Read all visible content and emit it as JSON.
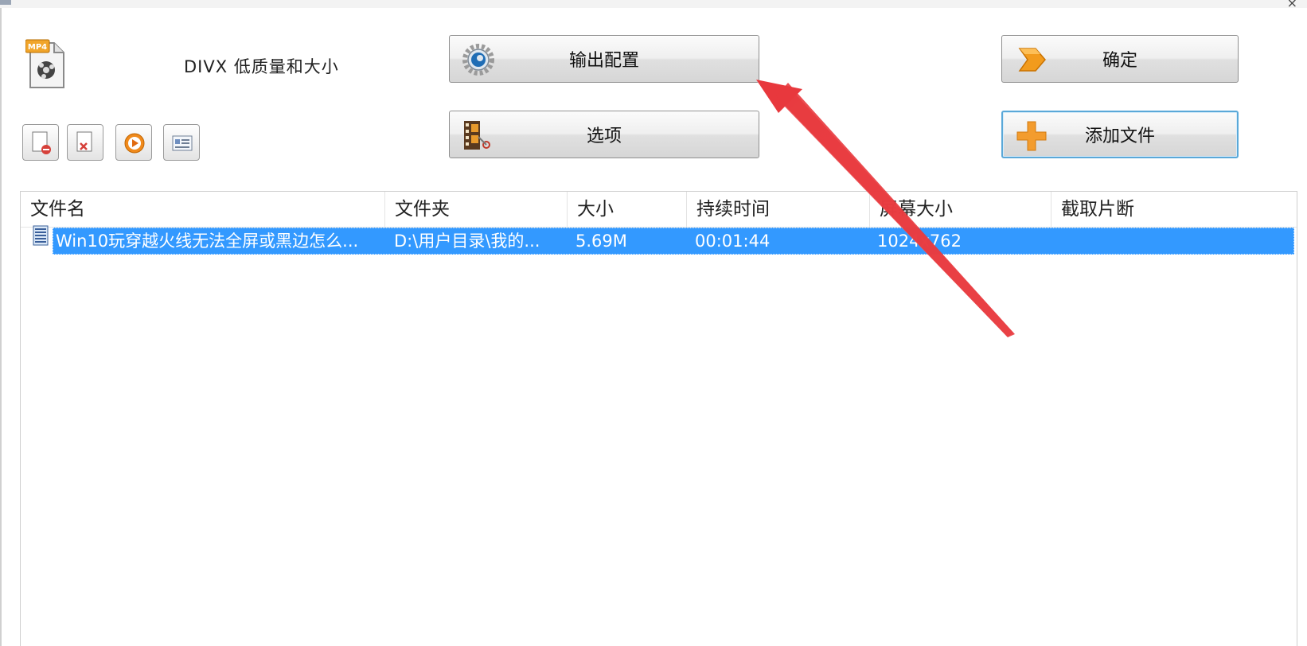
{
  "window": {
    "close_glyph": "×"
  },
  "profile": {
    "label": "DIVX 低质量和大小",
    "badge": "MP4"
  },
  "buttons": {
    "output_config": "输出配置",
    "options": "选项",
    "ok": "确定",
    "add_file": "添加文件"
  },
  "table": {
    "columns": [
      "文件名",
      "文件夹",
      "大小",
      "持续时间",
      "屏幕大小",
      "截取片断"
    ],
    "rows": [
      {
        "name": "Win10玩穿越火线无法全屏或黑边怎么...",
        "folder": "D:\\用户目录\\我的...",
        "size": "5.69M",
        "duration": "00:01:44",
        "resolution": "1024x762",
        "clip": ""
      }
    ]
  },
  "colors": {
    "selection": "#3399ff",
    "annotation_arrow": "#e8383d",
    "focus_border": "#5aa8d8"
  }
}
